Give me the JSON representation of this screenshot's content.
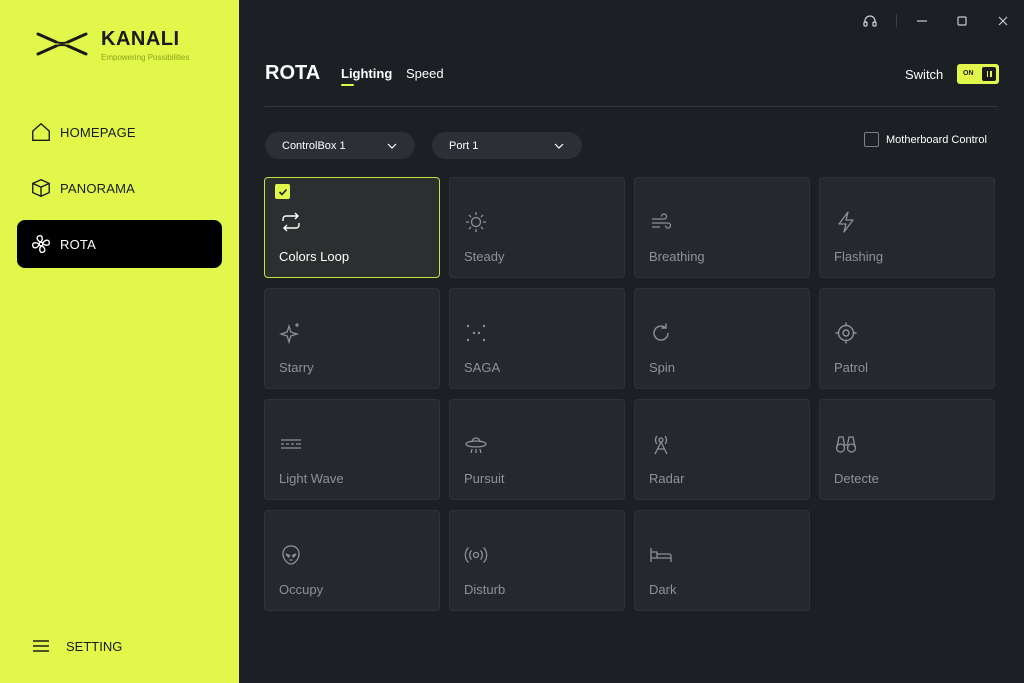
{
  "sidebar": {
    "brand": "KANALI",
    "tagline": "Empowering Possibilities",
    "items": [
      {
        "label": "HOMEPAGE",
        "icon": "home-icon"
      },
      {
        "label": "PANORAMA",
        "icon": "box-icon"
      },
      {
        "label": "ROTA",
        "icon": "fan-icon",
        "active": true
      }
    ],
    "setting_label": "SETTING"
  },
  "header": {
    "title": "ROTA",
    "tabs": [
      {
        "label": "Lighting",
        "active": true
      },
      {
        "label": "Speed",
        "active": false
      }
    ],
    "switch_label": "Switch",
    "switch_state": "ON"
  },
  "controls": {
    "controlbox": "ControlBox 1",
    "port": "Port 1",
    "motherboard_label": "Motherboard Control",
    "motherboard_checked": false
  },
  "modes": [
    {
      "label": "Colors Loop",
      "icon": "loop-icon",
      "selected": true
    },
    {
      "label": "Steady",
      "icon": "sun-icon"
    },
    {
      "label": "Breathing",
      "icon": "wind-icon"
    },
    {
      "label": "Flashing",
      "icon": "lightning-icon"
    },
    {
      "label": "Starry",
      "icon": "sparkle-icon"
    },
    {
      "label": "SAGA",
      "icon": "dots-icon"
    },
    {
      "label": "Spin",
      "icon": "rotate-icon"
    },
    {
      "label": "Patrol",
      "icon": "crosshair-icon"
    },
    {
      "label": "Light Wave",
      "icon": "wave-icon"
    },
    {
      "label": "Pursuit",
      "icon": "ufo-icon"
    },
    {
      "label": "Radar",
      "icon": "radar-tower-icon"
    },
    {
      "label": "Detecte",
      "icon": "binoculars-icon"
    },
    {
      "label": "Occupy",
      "icon": "alien-icon"
    },
    {
      "label": "Disturb",
      "icon": "signal-icon"
    },
    {
      "label": "Dark",
      "icon": "bed-icon"
    }
  ],
  "colors": {
    "accent": "#e1f84a",
    "background": "#1c1f23",
    "card": "#25292e"
  }
}
